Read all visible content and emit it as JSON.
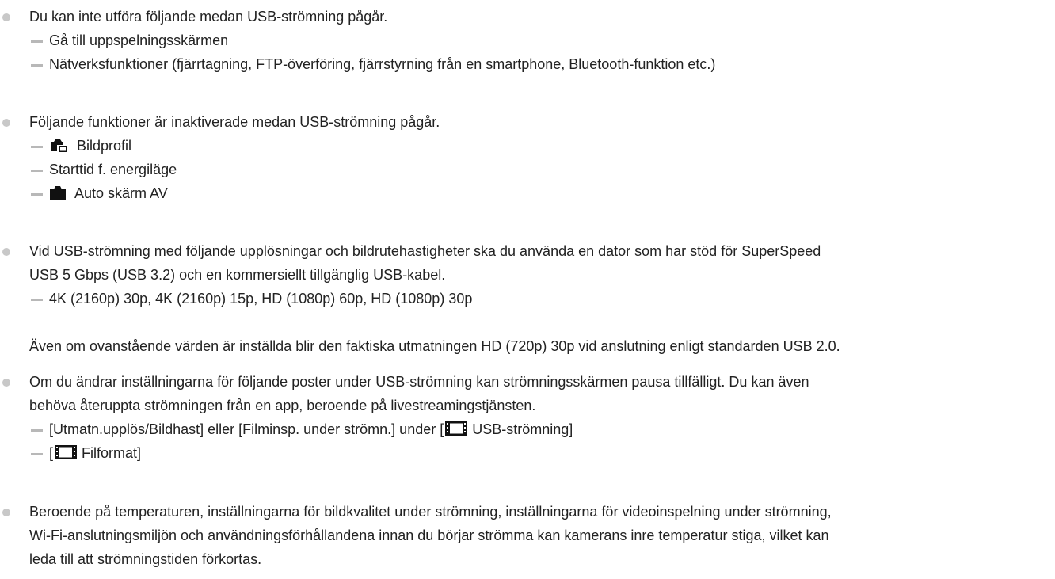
{
  "notes": [
    {
      "text": "Du kan inte utföra följande medan USB-strömning pågår.",
      "items": [
        "Gå till uppspelningsskärmen",
        "Nätverksfunktioner (fjärrtagning, FTP-överföring, fjärrstyrning från en smartphone, Bluetooth-funktion etc.)"
      ]
    },
    {
      "text": "Följande funktioner är inaktiverade medan USB-strömning pågår.",
      "items": [
        {
          "icon": "camera-movie-icon",
          "label": "Bildprofil"
        },
        {
          "label": "Starttid f. energiläge"
        },
        {
          "icon": "camera-icon",
          "label": "Auto skärm AV"
        }
      ]
    },
    {
      "text_line1": "Vid USB-strömning med följande upplösningar och bildrutehastigheter ska du använda en dator som har stöd för SuperSpeed",
      "text_line2": "USB 5 Gbps (USB 3.2) och en kommersiellt tillgänglig USB-kabel.",
      "items": [
        "4K (2160p) 30p, 4K (2160p) 15p, HD (1080p) 60p, HD (1080p) 30p"
      ],
      "followup": "Även om ovanstående värden är inställda blir den faktiska utmatningen HD (720p) 30p vid anslutning enligt standarden USB 2.0."
    },
    {
      "text_line1": "Om du ändrar inställningarna för följande poster under USB-strömning kan strömningsskärmen pausa tillfälligt. Du kan även",
      "text_line2": "behöva återuppta strömningen från en app, beroende på livestreamingstjänsten.",
      "items": [
        {
          "before": "[Utmatn.upplös/Bildhast] eller [Filminsp. under strömn.] under [",
          "icon": "film-icon",
          "after": "USB-strömning]"
        },
        {
          "before": "[",
          "icon": "film-icon",
          "after": "Filformat]"
        }
      ]
    },
    {
      "text_line1": "Beroende på temperaturen, inställningarna för bildkvalitet under strömning, inställningarna för videoinspelning under strömning,",
      "text_line2": "Wi-Fi-anslutningsmiljön och användningsförhållandena innan du börjar strömma kan kamerans inre temperatur stiga, vilket kan",
      "text_line3": "leda till att strömningstiden förkortas."
    }
  ]
}
